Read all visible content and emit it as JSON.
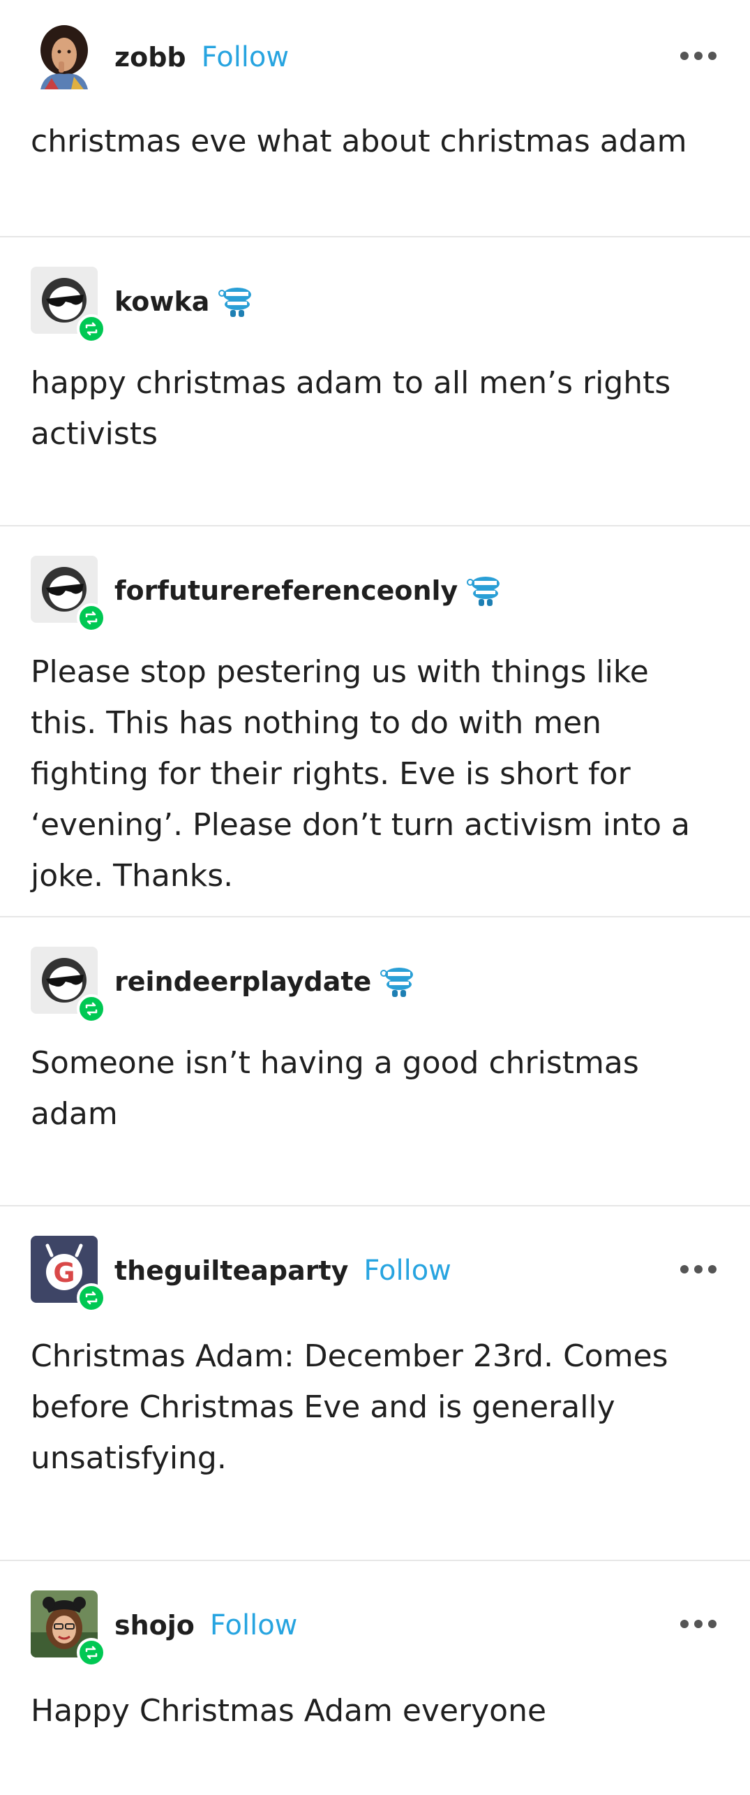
{
  "posts": [
    {
      "username": "zobb",
      "follow_label": "Follow",
      "has_follow": true,
      "has_more_menu": true,
      "reblogged": false,
      "avatar_icon": "person-photo-icon",
      "text": "christmas eve what about christmas adam"
    },
    {
      "username": "kowka",
      "has_follow": false,
      "has_more_menu": false,
      "reblogged": true,
      "avatar_icon": "sunglasses-face-icon",
      "badge_icon": "chattering-teeth-icon",
      "text": "happy christmas adam to all men’s rights activists"
    },
    {
      "username": "forfuturereferenceonly",
      "has_follow": false,
      "has_more_menu": false,
      "reblogged": true,
      "avatar_icon": "sunglasses-face-icon",
      "badge_icon": "chattering-teeth-icon",
      "text": "Please stop pestering us with things like this. This has nothing to do with men fighting for their rights. Eve is short for ‘evening’. Please don’t turn activism into a joke. Thanks."
    },
    {
      "username": "reindeerplaydate",
      "has_follow": false,
      "has_more_menu": false,
      "reblogged": true,
      "avatar_icon": "sunglasses-face-icon",
      "badge_icon": "chattering-teeth-icon",
      "text": "Someone isn’t having a good christmas adam"
    },
    {
      "username": "theguilteaparty",
      "follow_label": "Follow",
      "has_follow": true,
      "has_more_menu": true,
      "reblogged": true,
      "avatar_icon": "g-logo-icon",
      "text": "Christmas Adam: December 23rd. Comes before Christmas Eve and is generally unsatisfying."
    },
    {
      "username": "shojo",
      "follow_label": "Follow",
      "has_follow": true,
      "has_more_menu": true,
      "reblogged": true,
      "avatar_icon": "person-photo-icon",
      "text": "Happy Christmas Adam everyone"
    }
  ],
  "colors": {
    "follow": "#27a4e0",
    "reblog_badge": "#00c853",
    "text": "#1f1f1f",
    "divider": "#e6e6e6"
  }
}
